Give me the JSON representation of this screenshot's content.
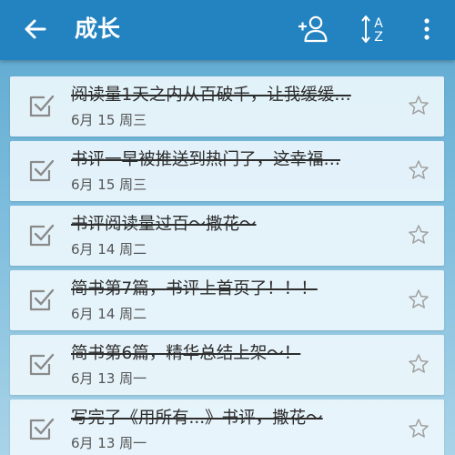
{
  "colors": {
    "toolbar": "#2383c0",
    "card": "#ecf6fc",
    "checkbox": "#8a8a8a",
    "star": "#a0a0a0"
  },
  "header": {
    "title": "成长",
    "back_icon": "arrow-left-icon",
    "actions": [
      {
        "name": "add-user",
        "icon": "person-plus-icon"
      },
      {
        "name": "sort",
        "icon": "sort-alpha-icon",
        "glyph_top": "A",
        "glyph_bottom": "Z"
      },
      {
        "name": "more",
        "icon": "more-vertical-icon"
      }
    ]
  },
  "tasks": [
    {
      "title": "阅读量1天之内从百破千，让我缓缓…",
      "date": "6月 15 周三",
      "completed": true,
      "starred": false
    },
    {
      "title": "书评一早被推送到热门了，这幸福…",
      "date": "6月 15 周三",
      "completed": true,
      "starred": false
    },
    {
      "title": "书评阅读量过百～撒花～",
      "date": "6月 14 周二",
      "completed": true,
      "starred": false
    },
    {
      "title": "简书第7篇，书评上首页了！！！",
      "date": "6月 14 周二",
      "completed": true,
      "starred": false
    },
    {
      "title": "简书第6篇，精华总结上架～！",
      "date": "6月 13 周一",
      "completed": true,
      "starred": false
    },
    {
      "title": "写完了《用所有...》书评，撒花～",
      "date": "6月 13 周一",
      "completed": true,
      "starred": false
    }
  ]
}
